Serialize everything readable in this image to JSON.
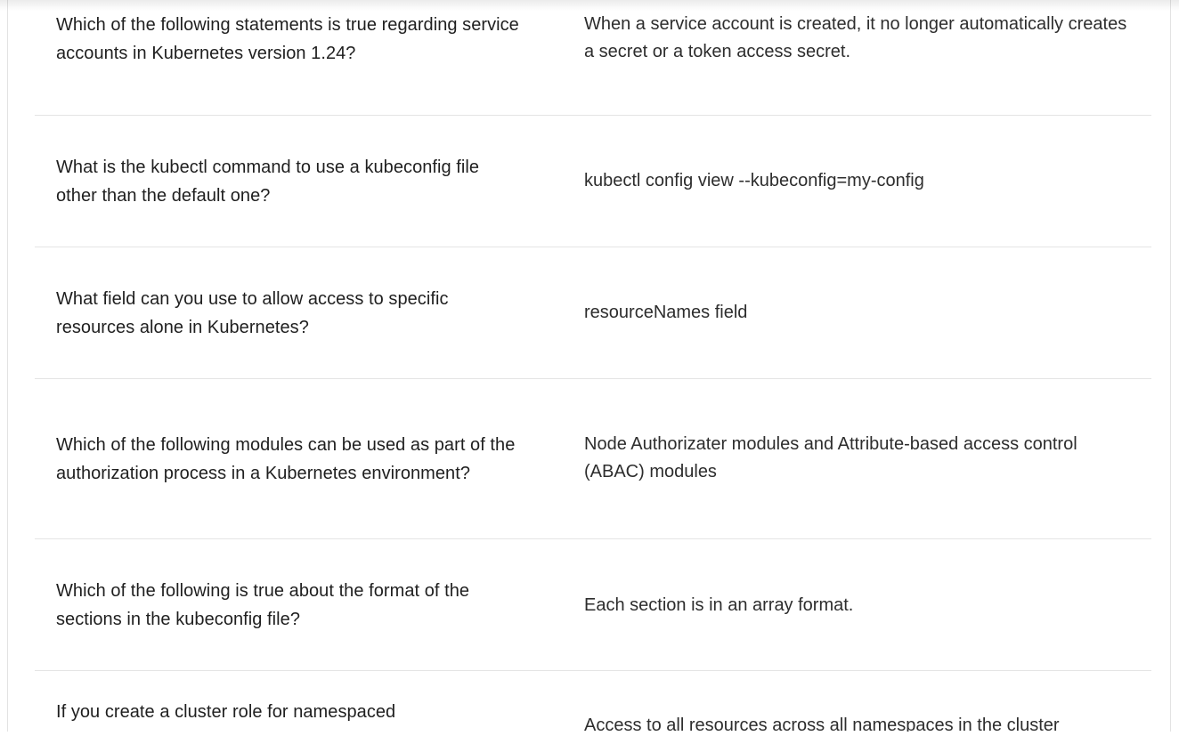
{
  "cards": [
    {
      "term": "Which of the following statements is true regarding service accounts in Kubernetes version 1.24?",
      "definition": "When a service account is created, it no longer automatically creates a secret or a token access secret."
    },
    {
      "term": "What is the kubectl command to use a kubeconfig file other than the default one?",
      "definition": "kubectl config view --kubeconfig=my-config"
    },
    {
      "term": "What field can you use to allow access to specific resources alone in Kubernetes?",
      "definition": "resourceNames field"
    },
    {
      "term": "Which of the following modules can be used as part of the authorization process in a Kubernetes environment?",
      "definition": "Node Authorizater modules and Attribute-based access control (ABAC) modules"
    },
    {
      "term": "Which of the following is true about the format of the sections in the kubeconfig file?",
      "definition": "Each section is in an array format."
    },
    {
      "term": "If you create a cluster role for namespaced",
      "definition": "Access to all resources across all namespaces in the cluster"
    }
  ]
}
